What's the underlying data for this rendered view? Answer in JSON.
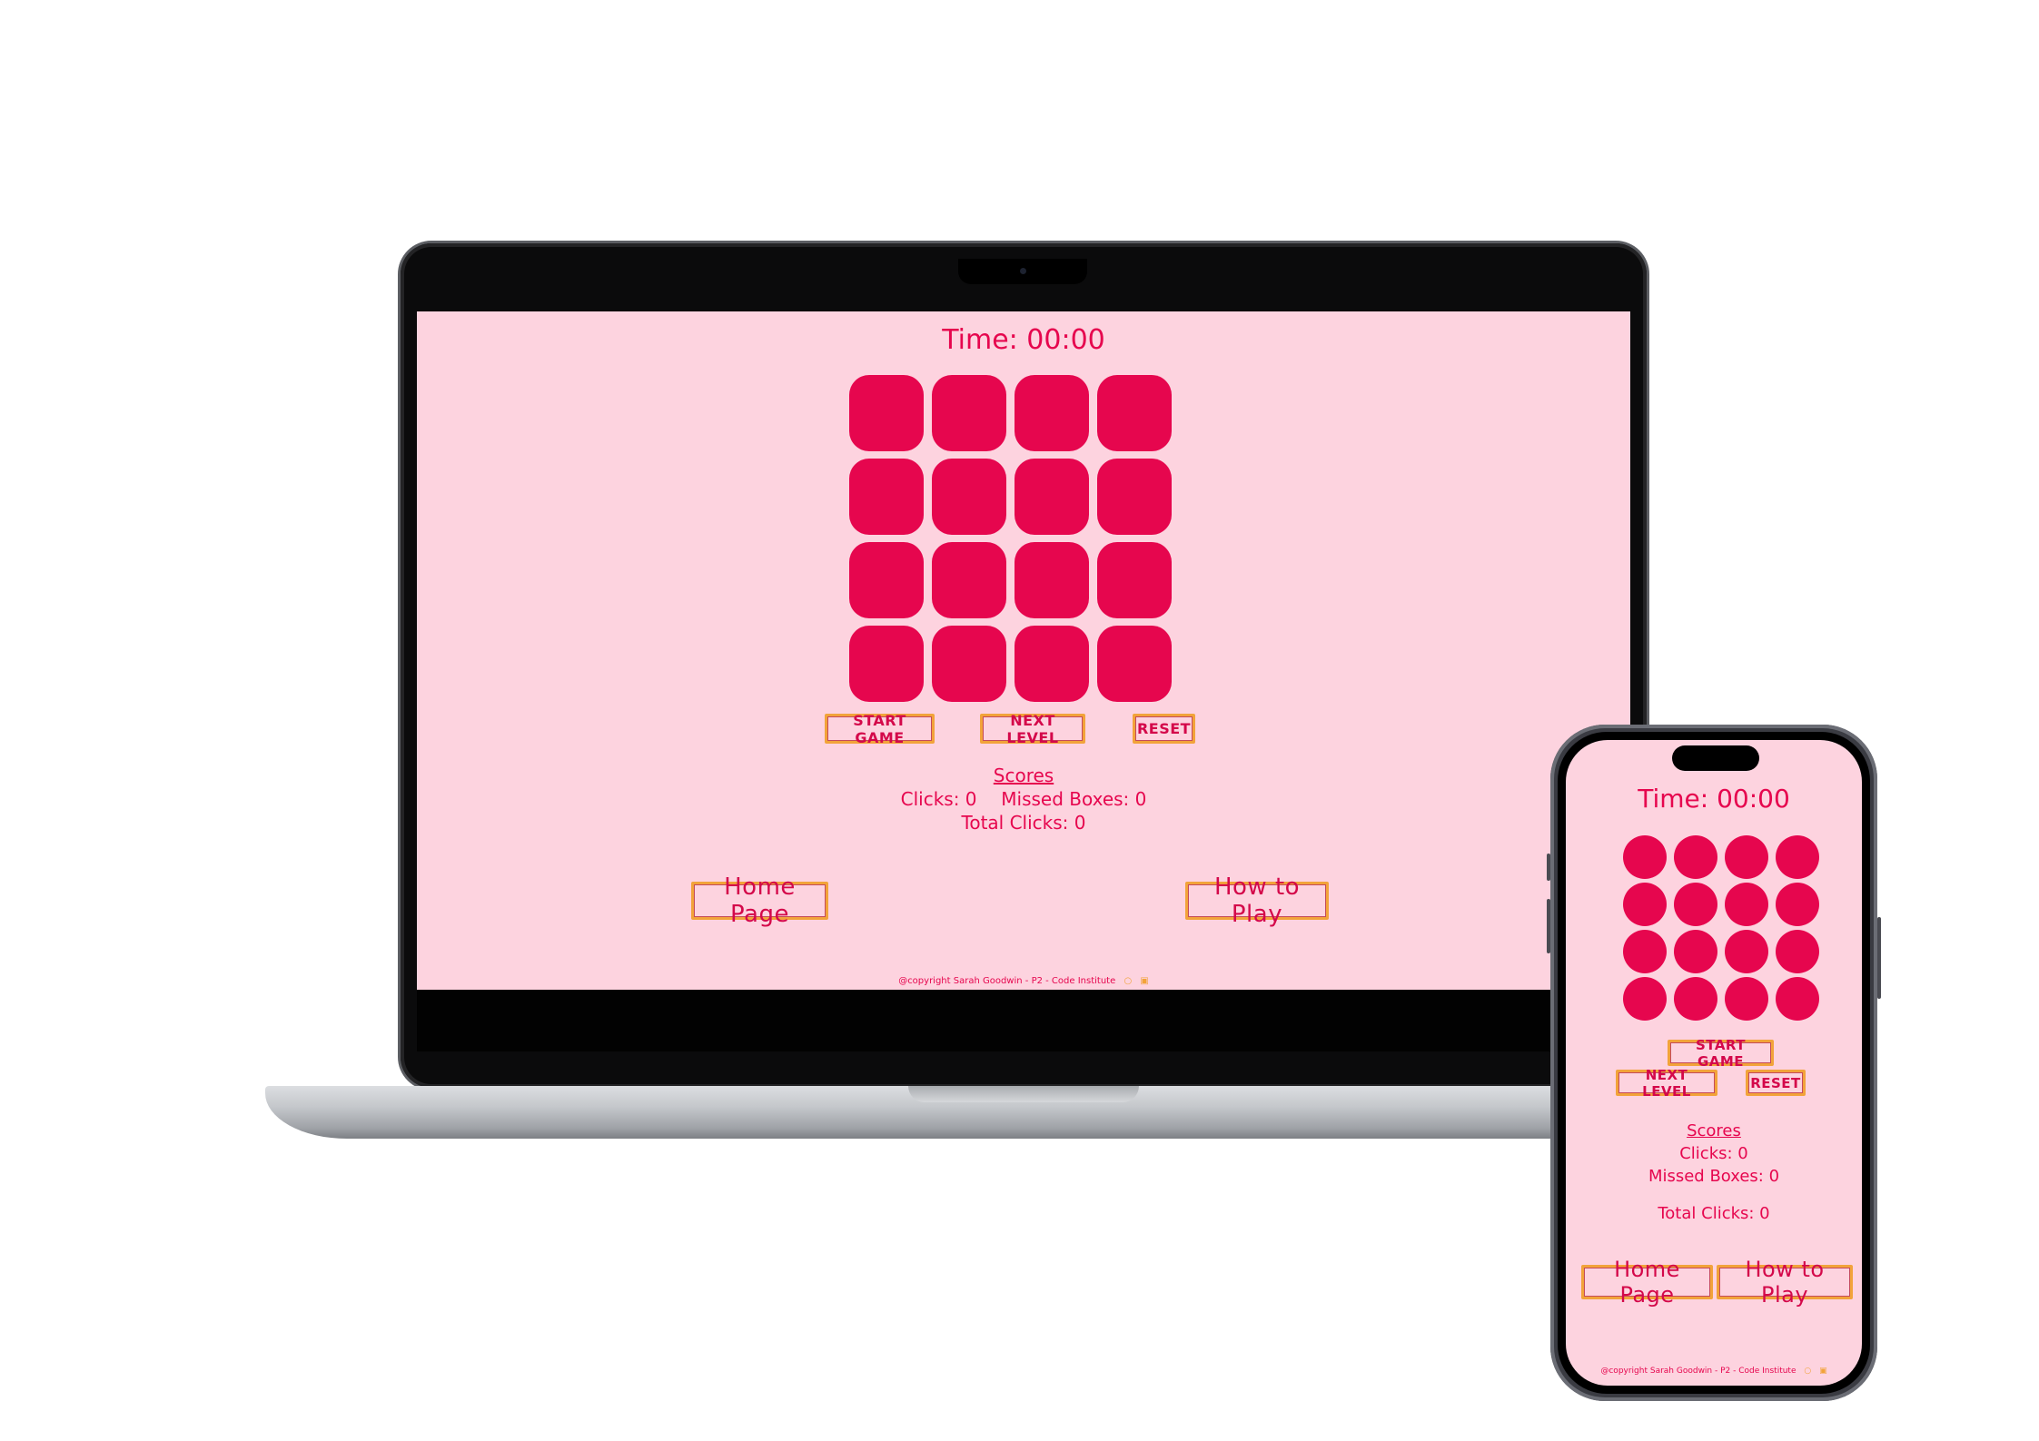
{
  "game": {
    "timer_label": "Time: 00:00",
    "grid_rows": 4,
    "grid_cols": 4,
    "buttons": {
      "start": "START GAME",
      "next": "NEXT LEVEL",
      "reset": "RESET"
    },
    "scores": {
      "title": "Scores",
      "clicks": "Clicks: 0",
      "missed": "Missed Boxes: 0",
      "total": "Total Clicks: 0"
    },
    "nav": {
      "home": "Home Page",
      "how_to_play": "How to Play"
    },
    "footer": "@copyright Sarah Goodwin - P2 - Code Institute",
    "footer_icons": [
      "github-icon",
      "linkedin-icon"
    ]
  },
  "colors": {
    "background": "#fdd3df",
    "accent": "#e6064e",
    "button_border": "#f2a33a"
  }
}
